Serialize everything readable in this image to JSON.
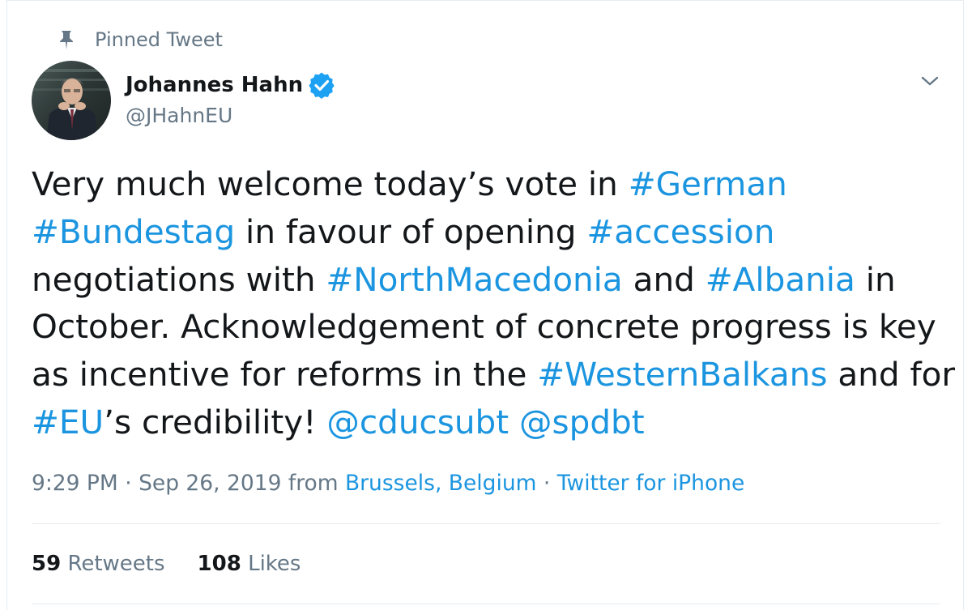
{
  "pinned": {
    "label": "Pinned Tweet",
    "icon": "pin-icon"
  },
  "author": {
    "name": "Johannes Hahn",
    "handle": "@JHahnEU",
    "verified_icon": "verified-badge-icon",
    "avatar_icon": "profile-photo"
  },
  "menu": {
    "icon": "chevron-down-icon"
  },
  "tweet": {
    "lines": [
      [
        {
          "t": "Very much welcome today’s vote in ",
          "k": "text"
        },
        {
          "t": "#German",
          "k": "tag"
        }
      ],
      [
        {
          "t": " ",
          "k": "text"
        },
        {
          "t": "#Bundestag",
          "k": "tag"
        },
        {
          "t": " in favour of opening ",
          "k": "text"
        },
        {
          "t": "#accession",
          "k": "tag"
        }
      ],
      [
        {
          "t": " negotiations with ",
          "k": "text"
        },
        {
          "t": "#NorthMacedonia",
          "k": "tag"
        },
        {
          "t": " and ",
          "k": "text"
        },
        {
          "t": "#Albania",
          "k": "tag"
        },
        {
          "t": " in",
          "k": "text"
        }
      ],
      [
        {
          "t": "October. Acknowledgement of concrete progress is key",
          "k": "text"
        }
      ],
      [
        {
          "t": "as incentive for reforms in the ",
          "k": "text"
        },
        {
          "t": "#WesternBalkans",
          "k": "tag"
        },
        {
          "t": " and for",
          "k": "text"
        }
      ],
      [
        {
          "t": "#EU",
          "k": "tag"
        },
        {
          "t": "’s credibility! ",
          "k": "text"
        },
        {
          "t": "@cducsubt",
          "k": "mention"
        },
        {
          "t": " ",
          "k": "text"
        },
        {
          "t": "@spdbt",
          "k": "mention"
        }
      ]
    ]
  },
  "meta": {
    "time": "9:29 PM",
    "sep1": " · ",
    "date": "Sep 26, 2019",
    "from": " from ",
    "location": "Brussels, Belgium",
    "sep2": " · ",
    "client": "Twitter for iPhone"
  },
  "stats": {
    "retweets_count": "59",
    "retweets_label": " Retweets",
    "likes_count": "108",
    "likes_label": " Likes"
  },
  "colors": {
    "link": "#1b95e0",
    "secondary_text": "#657786",
    "primary_text": "#14171a",
    "verified": "#1da1f2",
    "divider": "#e6ecf0"
  }
}
